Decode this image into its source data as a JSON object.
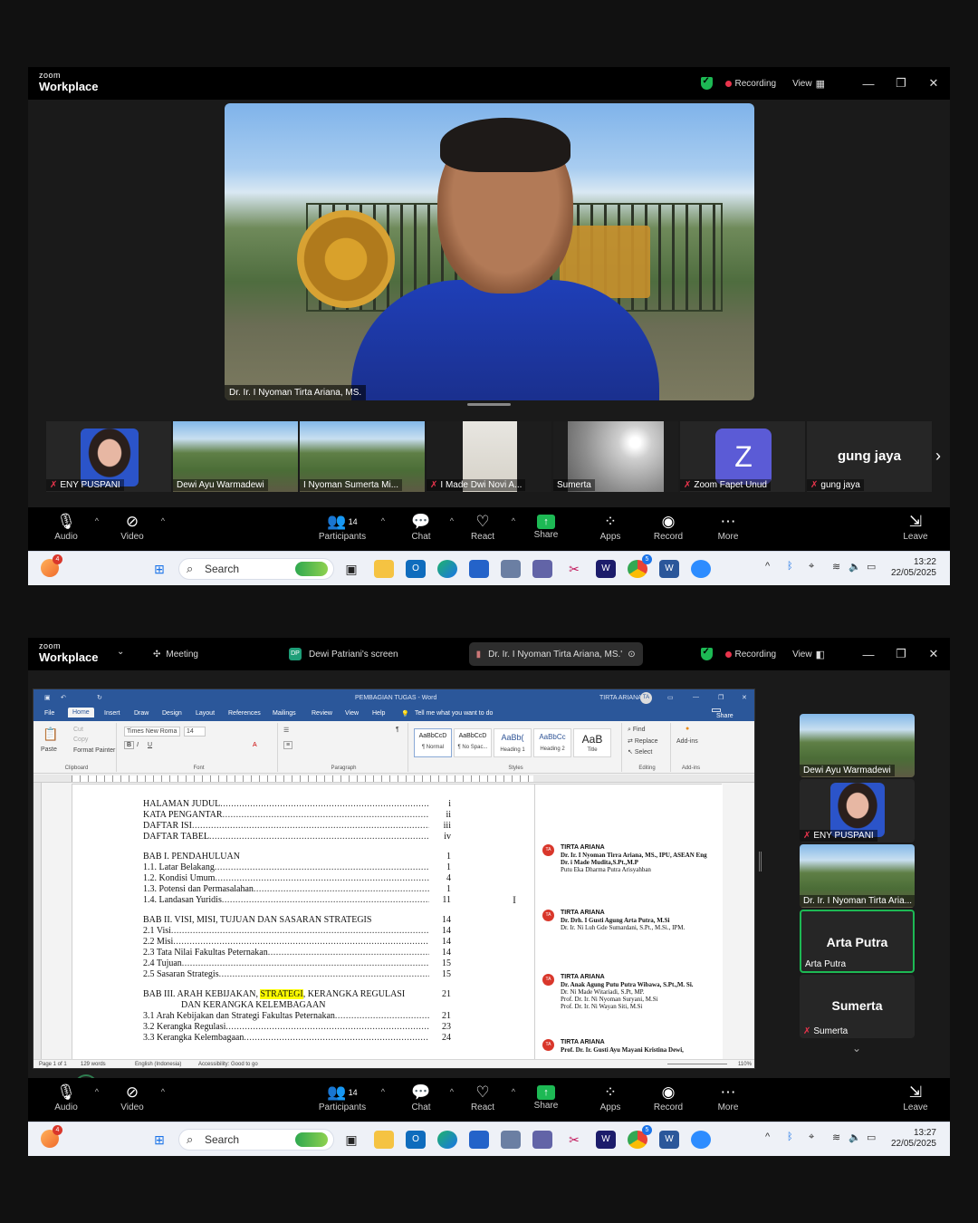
{
  "window1": {
    "logo_top": "zoom",
    "logo_bottom": "Workplace",
    "recording_label": "Recording",
    "view_label": "View",
    "speaker_name": "Dr. Ir. I Nyoman Tirta Ariana, MS.",
    "participants_strip": [
      {
        "name": "ENY PUSPANI",
        "muted": true
      },
      {
        "name": "Dewi Ayu Warmadewi",
        "muted": false
      },
      {
        "name": "I Nyoman Sumerta Mi...",
        "muted": false
      },
      {
        "name": "I Made Dwi Novi A...",
        "muted": true
      },
      {
        "name": "Sumerta",
        "muted": false
      },
      {
        "name": "Zoom Fapet Unud",
        "muted": true,
        "initial": "Z"
      },
      {
        "name": "gung jaya",
        "muted": true,
        "display": "gung jaya"
      }
    ],
    "taskbar": {
      "search": "Search",
      "time": "13:22",
      "date": "22/05/2025",
      "notif_count": "4",
      "chrome_badge": "5"
    }
  },
  "controls": {
    "audio": "Audio",
    "video": "Video",
    "participants": "Participants",
    "participants_count": "14",
    "chat": "Chat",
    "react": "React",
    "share": "Share",
    "apps": "Apps",
    "record": "Record",
    "more": "More",
    "leave": "Leave"
  },
  "window2": {
    "logo_top": "zoom",
    "logo_bottom": "Workplace",
    "meeting_tab": "Meeting",
    "screen_tab": "Dewi Patriani's screen",
    "screen_tab_initials": "DP",
    "speaker_tab": "Dr. Ir. I Nyoman Tirta Ariana, MS.'",
    "recording_label": "Recording",
    "view_label": "View",
    "taskbar": {
      "search": "Search",
      "time": "13:27",
      "date": "22/05/2025",
      "notif_count": "4",
      "chrome_badge": "5"
    },
    "side_tiles": [
      {
        "name": "Dewi Ayu Warmadewi",
        "muted": false
      },
      {
        "name": "ENY PUSPANI",
        "muted": true
      },
      {
        "name": "Dr. Ir. I Nyoman Tirta Aria...",
        "muted": false
      },
      {
        "name": "Arta Putra",
        "display": "Arta Putra",
        "muted": false,
        "active": true
      },
      {
        "name": "Sumerta",
        "display": "Sumerta",
        "muted": true
      }
    ]
  },
  "word": {
    "doc_title": "PEMBAGIAN TUGAS - Word",
    "user": "TIRTA ARIANA",
    "user_initials": "TA",
    "share": "Share",
    "tabs": [
      "File",
      "Home",
      "Insert",
      "Draw",
      "Design",
      "Layout",
      "References",
      "Mailings",
      "Review",
      "View",
      "Help"
    ],
    "tell_me": "Tell me what you want to do",
    "font_name": "Times New Roma",
    "font_size": "14",
    "clipboard": {
      "paste": "Paste",
      "cut": "Cut",
      "copy": "Copy",
      "format_painter": "Format Painter",
      "label": "Clipboard"
    },
    "groups": {
      "font": "Font",
      "paragraph": "Paragraph",
      "styles": "Styles",
      "editing": "Editing",
      "addins": "Add-ins"
    },
    "styles": [
      {
        "sample": "AaBbCcD",
        "name": "¶ Normal"
      },
      {
        "sample": "AaBbCcD",
        "name": "¶ No Spac..."
      },
      {
        "sample": "AaBb(",
        "name": "Heading 1"
      },
      {
        "sample": "AaBbCc",
        "name": "Heading 2"
      },
      {
        "sample": "AaB",
        "name": "Title"
      }
    ],
    "editing": {
      "find": "Find",
      "replace": "Replace",
      "select": "Select"
    },
    "addins_label": "Add-ins",
    "toc": [
      {
        "text": "HALAMAN JUDUL",
        "page": "i"
      },
      {
        "text": "KATA PENGANTAR",
        "page": "ii"
      },
      {
        "text": "DAFTAR ISI",
        "page": "iii"
      },
      {
        "text": "DAFTAR TABEL",
        "page": "iv"
      },
      {
        "text": "BAB I. PENDAHULUAN",
        "page": "1",
        "nodots": true
      },
      {
        "text": "1.1. Latar Belakang",
        "page": "1"
      },
      {
        "text": "1.2. Kondisi Umum",
        "page": "4"
      },
      {
        "text": "1.3. Potensi dan Permasalahan",
        "page": "1"
      },
      {
        "text": "1.4. Landasan Yuridis",
        "page": "11"
      },
      {
        "text": "BAB II. VISI, MISI, TUJUAN DAN SASARAN STRATEGIS",
        "page": "14",
        "nodots": true
      },
      {
        "text": "2.1  Visi",
        "page": "14"
      },
      {
        "text": "2.2  Misi",
        "page": "14"
      },
      {
        "text": "2.3  Tata Nilai Fakultas Peternakan",
        "page": "14"
      },
      {
        "text": "2.4  Tujuan",
        "page": "15"
      },
      {
        "text": "2.5  Sasaran Strategis",
        "page": "15"
      },
      {
        "text": "BAB III.  ARAH KEBIJAKAN, ",
        "highlight": "STRATEGI",
        "after": ", KERANGKA REGULASI",
        "page": "21",
        "nodots": true
      },
      {
        "text": "DAN KERANGKA KELEMBAGAAN",
        "page": "",
        "nodots": true,
        "indent": true
      },
      {
        "text": "3.1  Arah Kebijakan dan Strategi Fakultas Peternakan",
        "page": "21"
      },
      {
        "text": "3.2  Kerangka Regulasi",
        "page": "23"
      },
      {
        "text": "3.3  Kerangka Kelembagaan",
        "page": "24"
      }
    ],
    "comments": [
      {
        "author": "TIRTA ARIANA",
        "lines": [
          "Dr. Ir. I Nyoman Tirra Ariana, MS., IPU, ASEAN Eng",
          "Dr. i Made Mudita,S.Pt.,M.P",
          "Putu Eka Dharma Putra Arisyahban"
        ]
      },
      {
        "author": "TIRTA ARIANA",
        "lines": [
          "Dr. Drh. I Gusti Agung Arta Putra, M.Si",
          "Dr. Ir. Ni Luh Gde Sumardani, S.Pt., M.Si., IPM."
        ]
      },
      {
        "author": "TIRTA ARIANA",
        "lines": [
          "Dr. Anak Agung Putu Putra Wibawa, S.Pt.,M. Si.",
          "Dr. Ni Made Witariadi, S.Pt, MP.",
          "Prof. Dr. Ir. Ni Nyoman Suryani, M.Si",
          "Prof. Dr. Ir. Ni Wayan Siti, M.Si"
        ]
      },
      {
        "author": "TIRTA ARIANA",
        "lines": [
          "Prof. Dr. Ir. Gusti Ayu Mayani Kristina Dewi,"
        ]
      }
    ],
    "status": {
      "page": "Page 1 of 1",
      "words": "129 words",
      "lang": "English (Indonesia)",
      "access": "Accessibility: Good to go",
      "zoom": "110%"
    }
  }
}
